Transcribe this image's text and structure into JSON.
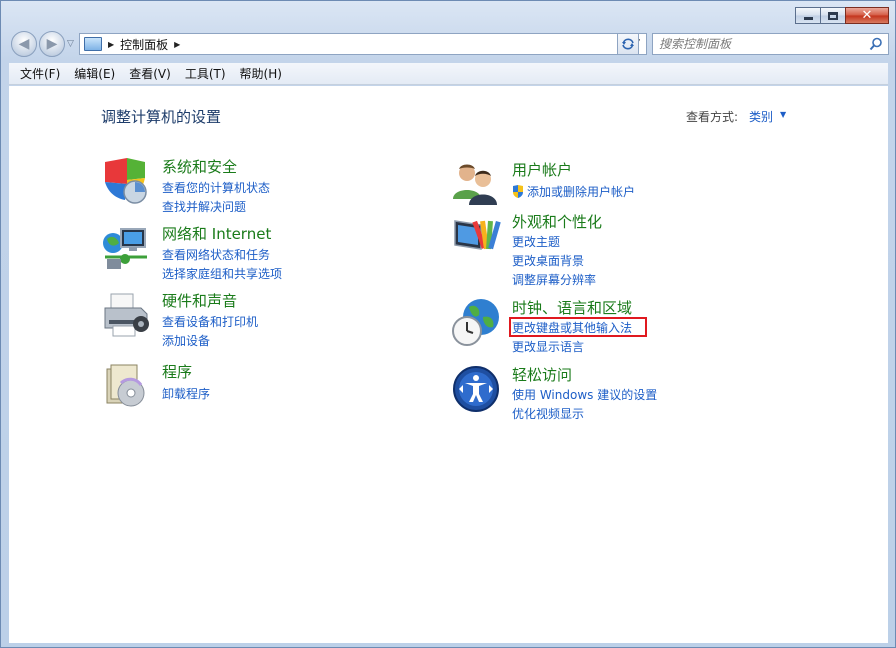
{
  "window": {
    "close_glyph": "✕"
  },
  "nav": {
    "back_icon": "◀",
    "forward_icon": "▶"
  },
  "address": {
    "crumb": "控制面板"
  },
  "search": {
    "placeholder": "搜索控制面板"
  },
  "menu": {
    "items": [
      "文件(F)",
      "编辑(E)",
      "查看(V)",
      "工具(T)",
      "帮助(H)"
    ]
  },
  "main": {
    "title": "调整计算机的设置",
    "view_label": "查看方式:",
    "view_value": "类别"
  },
  "categories": [
    {
      "title": "系统和安全",
      "icon": "shield-icon",
      "links": [
        "查看您的计算机状态",
        "查找并解决问题"
      ]
    },
    {
      "title": "网络和 Internet",
      "icon": "network-icon",
      "links": [
        "查看网络状态和任务",
        "选择家庭组和共享选项"
      ]
    },
    {
      "title": "硬件和声音",
      "icon": "printer-icon",
      "links": [
        "查看设备和打印机",
        "添加设备"
      ]
    },
    {
      "title": "程序",
      "icon": "programs-icon",
      "links": [
        "卸载程序"
      ]
    },
    {
      "title": "用户帐户",
      "icon": "users-icon",
      "links": [
        "添加或删除用户帐户"
      ]
    },
    {
      "title": "外观和个性化",
      "icon": "monitor-palette-icon",
      "links": [
        "更改主题",
        "更改桌面背景",
        "调整屏幕分辨率"
      ]
    },
    {
      "title": "时钟、语言和区域",
      "icon": "globe-clock-icon",
      "links": [
        "更改键盘或其他输入法",
        "更改显示语言"
      ]
    },
    {
      "title": "轻松访问",
      "icon": "ease-of-access-icon",
      "links": [
        "使用 Windows 建议的设置",
        "优化视频显示"
      ]
    }
  ],
  "colors": {
    "title_green": "#1a7b1a",
    "link_blue": "#1d5ec7",
    "highlight_red": "#e0191f"
  }
}
